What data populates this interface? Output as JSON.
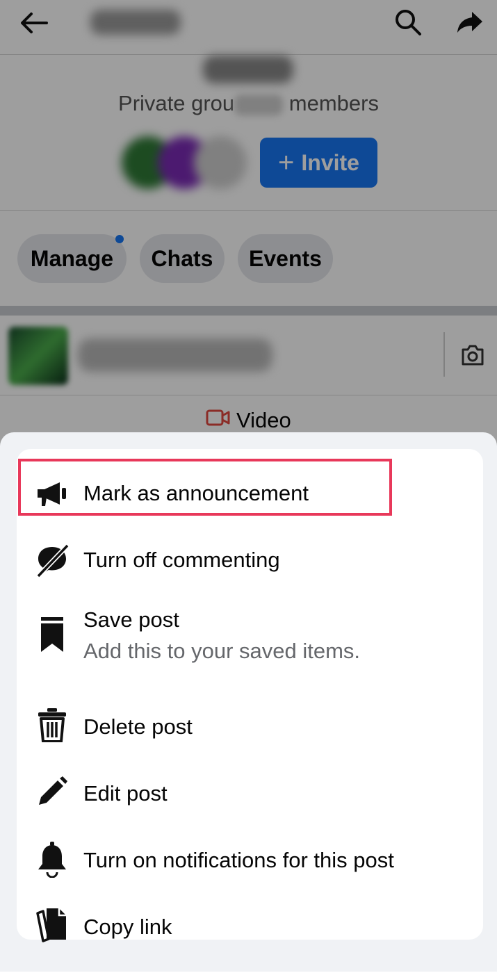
{
  "header": {
    "back_icon": "arrow-left-icon",
    "search_icon": "search-icon",
    "share_icon": "share-arrow-icon"
  },
  "group": {
    "privacy_text": "Private grou",
    "members_text": "members",
    "invite_label": "Invite"
  },
  "tabs": [
    {
      "label": "Manage",
      "has_dot": true
    },
    {
      "label": "Chats"
    },
    {
      "label": "Events"
    }
  ],
  "composer": {
    "camera_icon": "camera-icon",
    "video_label": "Video"
  },
  "menu": {
    "items": [
      {
        "label": "Mark as announcement",
        "icon": "megaphone-icon",
        "highlighted": true
      },
      {
        "label": "Turn off commenting",
        "icon": "comment-off-icon"
      },
      {
        "label": "Save post",
        "sublabel": "Add this to your saved items.",
        "icon": "bookmark-icon"
      },
      {
        "label": "Delete post",
        "icon": "trash-icon"
      },
      {
        "label": "Edit post",
        "icon": "pencil-icon"
      },
      {
        "label": "Turn on notifications for this post",
        "icon": "bell-icon"
      },
      {
        "label": "Copy link",
        "icon": "copy-icon"
      }
    ]
  },
  "colors": {
    "accent": "#1877f2",
    "highlight_border": "#e8385a",
    "video_icon": "#e1483f",
    "sheet_bg": "#f0f2f5"
  }
}
